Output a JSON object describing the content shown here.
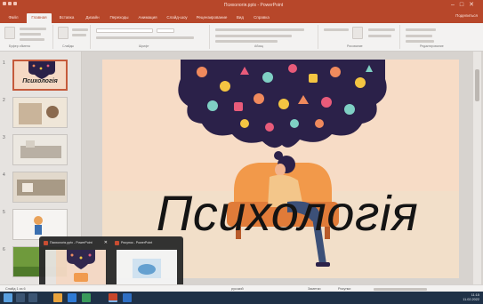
{
  "window": {
    "title": "Психологія.pptx  -  PowerPoint"
  },
  "ribbon": {
    "tabs": [
      {
        "label": "Файл",
        "active": false
      },
      {
        "label": "Главная",
        "active": true
      },
      {
        "label": "Вставка",
        "active": false
      },
      {
        "label": "Дизайн",
        "active": false
      },
      {
        "label": "Переходы",
        "active": false
      },
      {
        "label": "Анимация",
        "active": false
      },
      {
        "label": "Слайд-шоу",
        "active": false
      },
      {
        "label": "Рецензирование",
        "active": false
      },
      {
        "label": "Вид",
        "active": false
      },
      {
        "label": "Справка",
        "active": false
      }
    ],
    "share_label": "Поделиться",
    "groups": [
      {
        "label": "Буфер обмена"
      },
      {
        "label": "Слайды"
      },
      {
        "label": "Шрифт"
      },
      {
        "label": "Абзац"
      },
      {
        "label": "Рисование"
      },
      {
        "label": "Редактирование"
      }
    ]
  },
  "slides": {
    "items": [
      {
        "number": "1",
        "title": "Психологія",
        "selected": true,
        "bg": "#f5d9c5"
      },
      {
        "number": "2",
        "title": "",
        "selected": false,
        "bg": "#e9e0d3"
      },
      {
        "number": "3",
        "title": "",
        "selected": false,
        "bg": "#e7e3dc"
      },
      {
        "number": "4",
        "title": "",
        "selected": false,
        "bg": "#dcd3c7"
      },
      {
        "number": "5",
        "title": "",
        "selected": false,
        "bg": "#f2f0ee"
      },
      {
        "number": "6",
        "title": "",
        "selected": false,
        "bg": "#6f9a3c"
      }
    ]
  },
  "slide": {
    "title": "Психологія",
    "background": "#f7dcc6",
    "accent": "#2b2149"
  },
  "preview": {
    "items": [
      {
        "title": "Психологія.pptx - PowerPoint"
      },
      {
        "title": "Рисунок - PowerPoint"
      }
    ]
  },
  "status": {
    "slide_info": "Слайд 1 из 6",
    "language": "русский",
    "notes": "Заметки",
    "zoom": "Рисунки"
  },
  "taskbar": {
    "time": "11:15",
    "date": "11.02.2022"
  },
  "colors": {
    "brand": "#b7472a",
    "taskbar": "#1f3147",
    "selection": "#c55a3b"
  }
}
